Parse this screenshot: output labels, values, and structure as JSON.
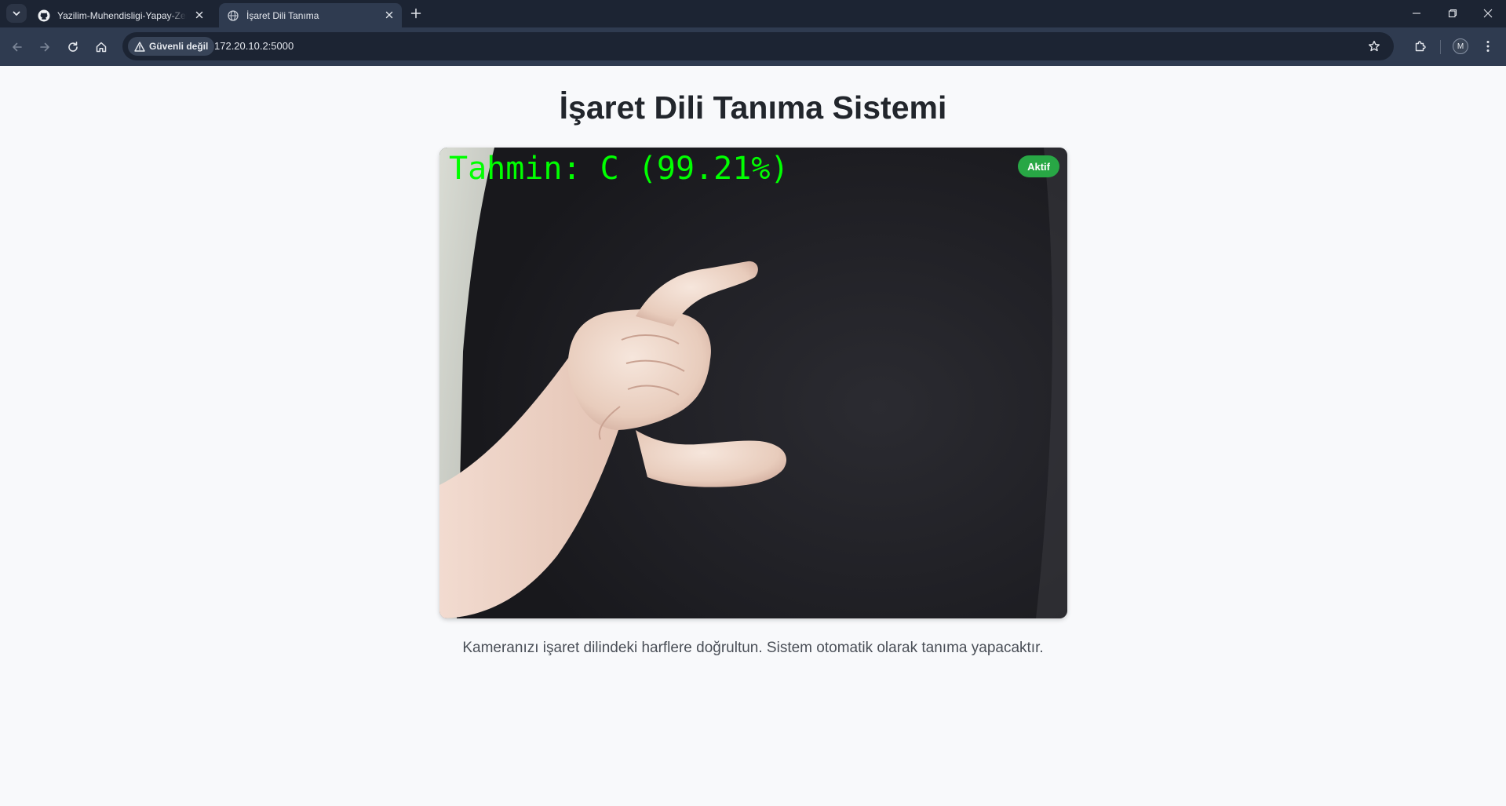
{
  "browser": {
    "tabs": [
      {
        "title": "Yazilim-Muhendisligi-Yapay-Zeka",
        "icon": "github-icon",
        "active": false
      },
      {
        "title": "İşaret Dili Tanıma",
        "icon": "globe-icon",
        "active": true
      }
    ],
    "security_label": "Güvenli değil",
    "url": "172.20.10.2:5000",
    "profile_initial": "M"
  },
  "page": {
    "title": "İşaret Dili Tanıma Sistemi",
    "prediction_text": "Tahmin: C (99.21%)",
    "status_badge": "Aktif",
    "instructions": "Kameranızı işaret dilindeki harflere doğrultun. Sistem otomatik olarak tanıma yapacaktır."
  },
  "colors": {
    "prediction": "#00ff00",
    "status_badge": "#28a745",
    "chrome_bg": "#1c2433",
    "toolbar_bg": "#2f3b50"
  }
}
